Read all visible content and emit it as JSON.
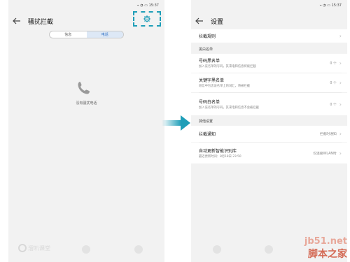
{
  "status_bar": {
    "time": "15:37",
    "icons": "signal-wifi-battery"
  },
  "left_screen": {
    "title": "骚扰拦截",
    "tabs": [
      {
        "label": "信息",
        "active": false
      },
      {
        "label": "电话",
        "active": true
      }
    ],
    "empty_text": "没有骚扰电话",
    "settings_icon": "gear-icon",
    "highlight_color": "#1e9eb8",
    "watermark": "溜叭课堂"
  },
  "arrow_color": "#1e9eb8",
  "right_screen": {
    "title": "设置",
    "rule_item": {
      "title": "拦截规则"
    },
    "section_blackwhite": "黑白名单",
    "blacklist": {
      "title": "号码黑名单",
      "subtitle": "加入该名单的号码，其来电和信息将被拦截",
      "value": "0 个"
    },
    "keyword_list": {
      "title": "关键字黑名单",
      "subtitle": "短信中包含该名单上的词汇，将被拦截",
      "value": "0 个"
    },
    "whitelist": {
      "title": "号码白名单",
      "subtitle": "加入该名单的号码，其来电和信息不会被拦截",
      "value": "0 个"
    },
    "section_other": "其他设置",
    "notify": {
      "title": "拦截通知",
      "value": "拦截时通知"
    },
    "auto_update": {
      "title": "自动更新智能识别库",
      "subtitle": "最近更新时间：8月18日 23:50",
      "value": "仅连接WLAN时"
    }
  },
  "site_watermark": {
    "url": "jb51.net",
    "name": "脚本之家"
  }
}
